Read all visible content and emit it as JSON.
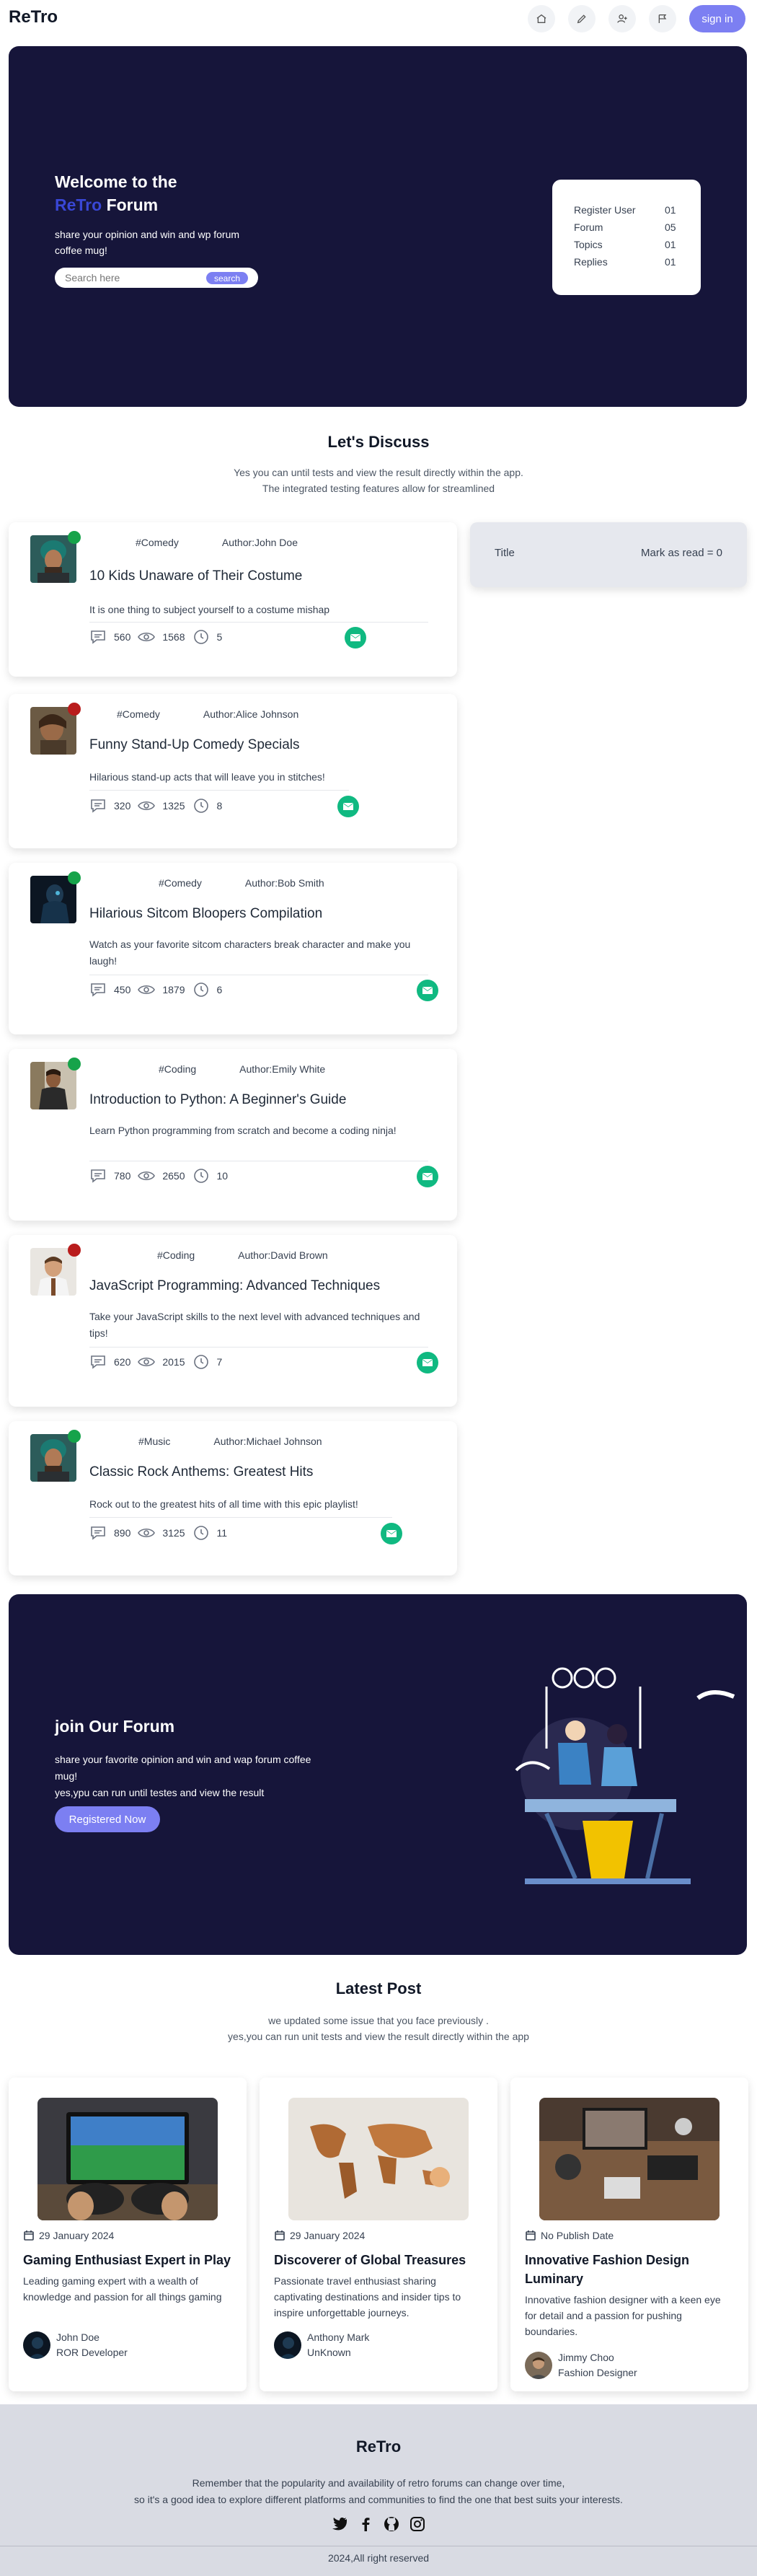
{
  "nav": {
    "brand": "ReTro",
    "icons": [
      "home-icon",
      "pencil-icon",
      "user-plus-icon",
      "flag-icon"
    ],
    "signin_label": "sign in"
  },
  "hero": {
    "title_line1": "Welcome to the",
    "title_accent": "ReTro",
    "title_rest": "Forum",
    "description": "share your opinion and win and wp forum coffee mug!",
    "search_placeholder": "Search here",
    "search_button": "search",
    "stats": [
      {
        "label": "Register User",
        "value": "01"
      },
      {
        "label": "Forum",
        "value": "05"
      },
      {
        "label": "Topics",
        "value": "01"
      },
      {
        "label": "Replies",
        "value": "01"
      }
    ]
  },
  "discuss": {
    "title": "Let's Discuss",
    "sub_line1": "Yes you can until tests and view the result directly within the app.",
    "sub_line2": "The integrated testing features allow for streamlined"
  },
  "read_panel": {
    "title": "Title",
    "mark_label": "Mark as read = 0"
  },
  "posts": [
    {
      "category": "#Comedy",
      "author": "Author:John Doe",
      "title": "10 Kids Unaware of Their Costume",
      "description": "It is one thing to subject yourself to a costume mishap",
      "comments": "560",
      "views": "1568",
      "time": "5",
      "status": "online"
    },
    {
      "category": "#Comedy",
      "author": "Author:Alice Johnson",
      "title": "Funny Stand-Up Comedy Specials",
      "description": "Hilarious stand-up acts that will leave you in stitches!",
      "comments": "320",
      "views": "1325",
      "time": "8",
      "status": "offline"
    },
    {
      "category": "#Comedy",
      "author": "Author:Bob Smith",
      "title": "Hilarious Sitcom Bloopers Compilation",
      "description": "Watch as your favorite sitcom characters break character and make you laugh!",
      "comments": "450",
      "views": "1879",
      "time": "6",
      "status": "online"
    },
    {
      "category": "#Coding",
      "author": "Author:Emily White",
      "title": "Introduction to Python: A Beginner's Guide",
      "description": "Learn Python programming from scratch and become a coding ninja!",
      "comments": "780",
      "views": "2650",
      "time": "10",
      "status": "online"
    },
    {
      "category": "#Coding",
      "author": "Author:David Brown",
      "title": "JavaScript Programming: Advanced Techniques",
      "description": "Take your JavaScript skills to the next level with advanced techniques and tips!",
      "comments": "620",
      "views": "2015",
      "time": "7",
      "status": "offline"
    },
    {
      "category": "#Music",
      "author": "Author:Michael Johnson",
      "title": "Classic Rock Anthems: Greatest Hits",
      "description": "Rock out to the greatest hits of all time with this epic playlist!",
      "comments": "890",
      "views": "3125",
      "time": "11",
      "status": "online"
    }
  ],
  "join": {
    "title": "join Our Forum",
    "desc_line1": "share your favorite opinion and win and wap forum coffee mug!",
    "desc_line2": "yes,ypu can run until testes and view the result",
    "button": "Registered Now"
  },
  "latest": {
    "title": "Latest Post",
    "sub_line1": "we updated some issue that you face previously .",
    "sub_line2": "yes,you can run unit tests and view the result directly within the app",
    "cards": [
      {
        "date": "29 January 2024",
        "title": "Gaming Enthusiast Expert in Play",
        "description": "Leading gaming expert with a wealth of knowledge and passion for all things gaming",
        "author": "John Doe",
        "role": "ROR Developer"
      },
      {
        "date": "29 January 2024",
        "title": "Discoverer of Global Treasures",
        "description": "Passionate travel enthusiast sharing captivating destinations and insider tips to inspire unforgettable journeys.",
        "author": "Anthony Mark",
        "role": "UnKnown"
      },
      {
        "date": "No Publish Date",
        "title": "Innovative Fashion Design Luminary",
        "description": "Innovative fashion designer with a keen eye for detail and a passion for pushing boundaries.",
        "author": "Jimmy Choo",
        "role": "Fashion Designer"
      }
    ]
  },
  "footer": {
    "brand": "ReTro",
    "line1": "Remember that the popularity and availability of retro forums can change over time,",
    "line2": "so it's a good idea to explore different platforms and communities to find the one that best suits your interests.",
    "social": [
      "twitter-icon",
      "facebook-icon",
      "github-icon",
      "instagram-icon"
    ],
    "copyright": "2024,All right reserved"
  },
  "colors": {
    "dark_panel": "#16153a",
    "accent": "#7c7ff2",
    "brand_blue": "#3947d6",
    "online": "#16a34a",
    "offline": "#b91c1c",
    "mail": "#10b981",
    "footer_bg": "#d9dbe3"
  }
}
